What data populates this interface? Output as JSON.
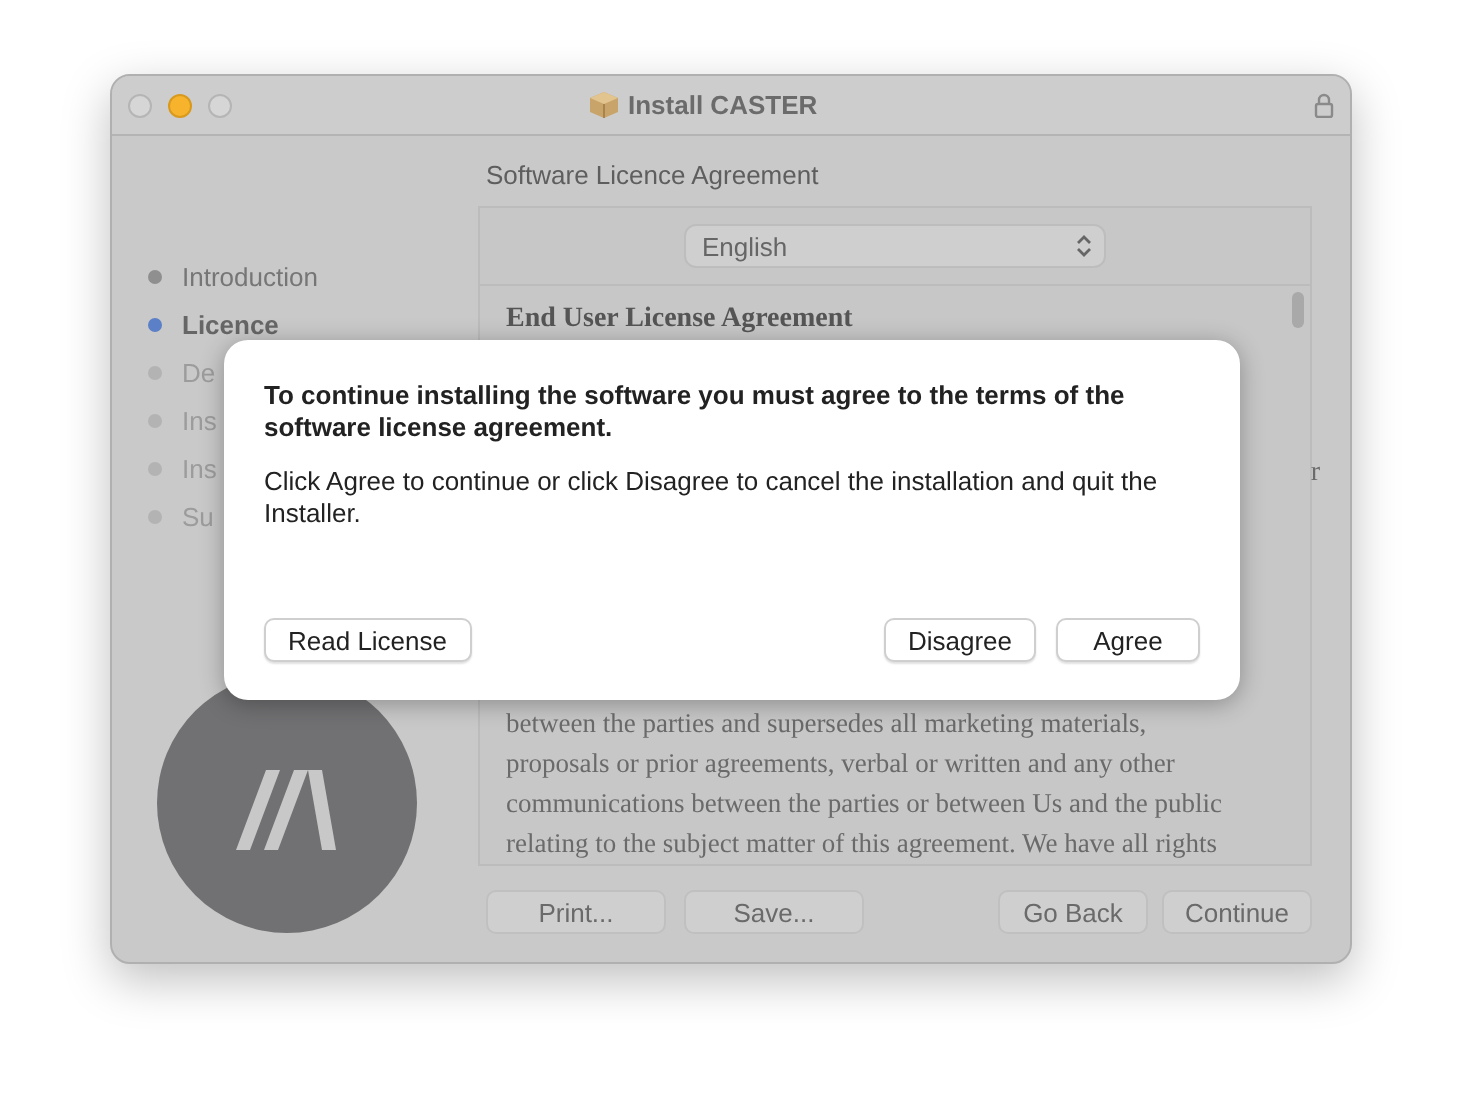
{
  "window": {
    "title": "Install CASTER"
  },
  "sidebar": {
    "items": [
      {
        "label": "Introduction",
        "done": true,
        "selected": false
      },
      {
        "label": "Licence",
        "done": false,
        "selected": true
      },
      {
        "label": "De",
        "done": false,
        "selected": false
      },
      {
        "label": "Ins",
        "done": false,
        "selected": false
      },
      {
        "label": "Ins",
        "done": false,
        "selected": false
      },
      {
        "label": "Su",
        "done": false,
        "selected": false
      }
    ]
  },
  "page": {
    "heading": "Software Licence Agreement",
    "language": "English",
    "license_lines": [
      {
        "text": "End User License Agreement",
        "kind": "heading"
      },
      {
        "text": "r",
        "kind": "fragment"
      },
      {
        "text": "between the parties and supersedes all marketing materials,",
        "kind": "body"
      },
      {
        "text": "proposals or prior agreements, verbal or written and any other",
        "kind": "body"
      },
      {
        "text": "communications between the parties or between Us and the public",
        "kind": "body"
      },
      {
        "text": "relating to the subject matter of this agreement. We have all rights",
        "kind": "body"
      }
    ],
    "buttons_left": [
      "Print...",
      "Save..."
    ],
    "buttons_right": [
      "Go Back",
      "Continue"
    ]
  },
  "dialog": {
    "title": "To continue installing the software you must agree to the terms of the software license agreement.",
    "message": "Click Agree to continue or click Disagree to cancel the installation and quit the Installer.",
    "buttons_left": [
      "Read License"
    ],
    "buttons_right": [
      "Disagree",
      "Agree"
    ]
  }
}
